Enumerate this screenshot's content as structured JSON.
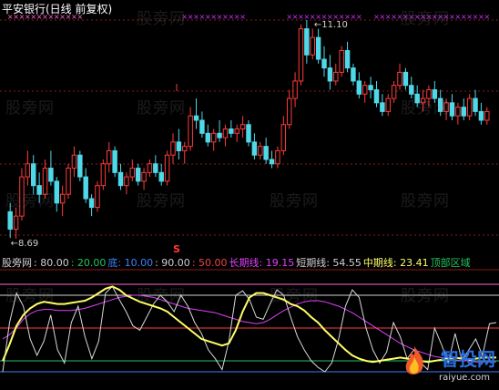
{
  "watermark": "股旁网",
  "title": "平安银行(日线 前复权)",
  "chart_data": [
    {
      "type": "candlestick",
      "name": "price",
      "annotations": {
        "high_label": "11.10",
        "low_label": "8.69",
        "signal_mark": "S"
      },
      "candles": [
        [
          9.0,
          9.1,
          8.7,
          8.8
        ],
        [
          8.8,
          9.05,
          8.69,
          8.95
        ],
        [
          8.95,
          9.5,
          8.9,
          9.4
        ],
        [
          9.4,
          9.7,
          9.3,
          9.55
        ],
        [
          9.55,
          9.65,
          9.2,
          9.3
        ],
        [
          9.3,
          9.45,
          9.1,
          9.2
        ],
        [
          9.2,
          9.6,
          9.15,
          9.5
        ],
        [
          9.5,
          9.7,
          9.3,
          9.35
        ],
        [
          9.35,
          9.4,
          9.0,
          9.1
        ],
        [
          9.1,
          9.3,
          8.95,
          9.2
        ],
        [
          9.2,
          9.55,
          9.15,
          9.5
        ],
        [
          9.5,
          9.75,
          9.4,
          9.65
        ],
        [
          9.65,
          9.7,
          9.35,
          9.4
        ],
        [
          9.4,
          9.5,
          9.1,
          9.15
        ],
        [
          9.15,
          9.2,
          8.95,
          9.05
        ],
        [
          9.05,
          9.35,
          9.0,
          9.3
        ],
        [
          9.3,
          9.6,
          9.25,
          9.55
        ],
        [
          9.55,
          9.8,
          9.45,
          9.7
        ],
        [
          9.7,
          9.75,
          9.4,
          9.45
        ],
        [
          9.45,
          9.55,
          9.25,
          9.3
        ],
        [
          9.3,
          9.45,
          9.2,
          9.4
        ],
        [
          9.4,
          9.6,
          9.35,
          9.5
        ],
        [
          9.5,
          9.55,
          9.3,
          9.35
        ],
        [
          9.35,
          9.5,
          9.25,
          9.45
        ],
        [
          9.45,
          9.6,
          9.4,
          9.55
        ],
        [
          9.55,
          9.65,
          9.4,
          9.45
        ],
        [
          9.45,
          9.55,
          9.3,
          9.35
        ],
        [
          9.35,
          9.7,
          9.3,
          9.65
        ],
        [
          9.65,
          9.9,
          9.55,
          9.8
        ],
        [
          9.8,
          9.95,
          9.6,
          9.7
        ],
        [
          9.7,
          9.8,
          9.55,
          9.75
        ],
        [
          9.75,
          10.2,
          9.7,
          10.1
        ],
        [
          10.1,
          10.3,
          9.95,
          10.05
        ],
        [
          10.05,
          10.15,
          9.85,
          9.9
        ],
        [
          9.9,
          10.0,
          9.75,
          9.8
        ],
        [
          9.8,
          9.95,
          9.7,
          9.9
        ],
        [
          9.9,
          10.05,
          9.8,
          9.85
        ],
        [
          9.85,
          10.0,
          9.75,
          9.95
        ],
        [
          9.95,
          10.05,
          9.85,
          9.9
        ],
        [
          9.9,
          10.0,
          9.8,
          9.95
        ],
        [
          9.95,
          10.1,
          9.85,
          10.0
        ],
        [
          10.0,
          10.05,
          9.75,
          9.8
        ],
        [
          9.8,
          9.9,
          9.6,
          9.65
        ],
        [
          9.65,
          9.8,
          9.6,
          9.75
        ],
        [
          9.75,
          9.85,
          9.55,
          9.6
        ],
        [
          9.6,
          9.7,
          9.5,
          9.55
        ],
        [
          9.55,
          9.75,
          9.5,
          9.7
        ],
        [
          9.7,
          10.1,
          9.65,
          10.0
        ],
        [
          10.0,
          10.4,
          9.95,
          10.3
        ],
        [
          10.3,
          10.6,
          10.2,
          10.5
        ],
        [
          10.5,
          11.15,
          10.45,
          11.1
        ],
        [
          11.1,
          11.2,
          10.7,
          10.8
        ],
        [
          10.8,
          11.1,
          10.75,
          11.0
        ],
        [
          11.0,
          11.1,
          10.7,
          10.75
        ],
        [
          10.75,
          10.9,
          10.55,
          10.65
        ],
        [
          10.65,
          10.8,
          10.4,
          10.5
        ],
        [
          10.5,
          10.7,
          10.45,
          10.6
        ],
        [
          10.6,
          10.9,
          10.55,
          10.85
        ],
        [
          10.85,
          10.95,
          10.6,
          10.65
        ],
        [
          10.65,
          10.7,
          10.45,
          10.5
        ],
        [
          10.5,
          10.6,
          10.3,
          10.35
        ],
        [
          10.35,
          10.5,
          10.25,
          10.45
        ],
        [
          10.45,
          10.55,
          10.3,
          10.4
        ],
        [
          10.4,
          10.5,
          10.2,
          10.25
        ],
        [
          10.25,
          10.35,
          10.1,
          10.15
        ],
        [
          10.15,
          10.35,
          10.1,
          10.3
        ],
        [
          10.3,
          10.5,
          10.25,
          10.45
        ],
        [
          10.45,
          10.7,
          10.4,
          10.6
        ],
        [
          10.6,
          10.65,
          10.4,
          10.45
        ],
        [
          10.45,
          10.55,
          10.3,
          10.35
        ],
        [
          10.35,
          10.45,
          10.2,
          10.25
        ],
        [
          10.25,
          10.4,
          10.15,
          10.3
        ],
        [
          10.3,
          10.45,
          10.2,
          10.4
        ],
        [
          10.4,
          10.5,
          10.25,
          10.3
        ],
        [
          10.3,
          10.4,
          10.1,
          10.15
        ],
        [
          10.15,
          10.3,
          10.05,
          10.25
        ],
        [
          10.25,
          10.35,
          10.05,
          10.1
        ],
        [
          10.1,
          10.25,
          10.0,
          10.2
        ],
        [
          10.2,
          10.3,
          10.05,
          10.1
        ],
        [
          10.1,
          10.35,
          10.05,
          10.3
        ],
        [
          10.3,
          10.4,
          10.1,
          10.15
        ],
        [
          10.15,
          10.25,
          10.0,
          10.05
        ],
        [
          10.05,
          10.2,
          10.0,
          10.15
        ]
      ],
      "signal_marks": [
        {
          "type": "pink",
          "range": [
            0,
            12
          ]
        },
        {
          "type": "magenta",
          "range": [
            30,
            40
          ]
        },
        {
          "type": "magenta",
          "range": [
            48,
            60
          ]
        },
        {
          "type": "magenta",
          "range": [
            63,
            83
          ]
        }
      ]
    },
    {
      "type": "line",
      "name": "indicator",
      "ylim": [
        0,
        100
      ],
      "header": [
        {
          "text": "股旁网",
          "color": "#d0d0d0"
        },
        {
          "text": ": 80.00",
          "color": "#d0d0d0"
        },
        {
          "text": ": 20.00",
          "color": "#22c55e"
        },
        {
          "text": "底: 10.00",
          "color": "#3b82f6"
        },
        {
          "text": ": 90.00",
          "color": "#d0d0d0"
        },
        {
          "text": ": 50.00",
          "color": "#ef4444"
        },
        {
          "text": "长期线: 19.15",
          "color": "#e040fb"
        },
        {
          "text": "短期线: 54.55",
          "color": "#d0d0d0"
        },
        {
          "text": "中期线: 23.41",
          "color": "#ffff66"
        },
        {
          "text": "顶部区域",
          "color": "#22c55e"
        }
      ],
      "hlines": [
        {
          "value": 90,
          "color": "#ff66cc"
        },
        {
          "value": 80,
          "color": "#d0d0d0"
        },
        {
          "value": 50,
          "color": "#ff3b3b"
        },
        {
          "value": 20,
          "color": "#22c55e"
        },
        {
          "value": 10,
          "color": "#3b82f6"
        }
      ],
      "series": [
        {
          "key": "long",
          "color": "#e040fb",
          "values": [
            40,
            44,
            50,
            58,
            63,
            66,
            67,
            67,
            66,
            66,
            66,
            67,
            68,
            70,
            72,
            74,
            76,
            78,
            79,
            80,
            80,
            79,
            78,
            76,
            74,
            72,
            70,
            68,
            67,
            66,
            65,
            64,
            62,
            60,
            58,
            56,
            55,
            54,
            55,
            58,
            62,
            66,
            69,
            72,
            74,
            75,
            75,
            74,
            72,
            70,
            67,
            64,
            60,
            56,
            52,
            48,
            44,
            40,
            36,
            33,
            30,
            28,
            26,
            24,
            23,
            22,
            21,
            20,
            20,
            19,
            19,
            19,
            19
          ]
        },
        {
          "key": "short",
          "color": "#d8d8d8",
          "values": [
            10,
            55,
            82,
            70,
            40,
            25,
            38,
            62,
            30,
            18,
            55,
            70,
            42,
            22,
            38,
            82,
            88,
            76,
            65,
            52,
            48,
            60,
            72,
            80,
            74,
            65,
            80,
            70,
            55,
            45,
            30,
            22,
            12,
            38,
            80,
            84,
            76,
            60,
            58,
            72,
            85,
            80,
            60,
            42,
            30,
            20,
            14,
            10,
            18,
            40,
            70,
            85,
            78,
            50,
            30,
            18,
            28,
            55,
            42,
            22,
            30,
            18,
            12,
            50,
            35,
            18,
            45,
            20,
            30,
            40,
            25,
            54,
            55
          ]
        },
        {
          "key": "mid",
          "color": "#ffff66",
          "values": [
            20,
            35,
            52,
            62,
            68,
            72,
            74,
            73,
            72,
            72,
            73,
            74,
            75,
            78,
            82,
            86,
            88,
            85,
            80,
            77,
            74,
            72,
            70,
            68,
            65,
            60,
            55,
            50,
            45,
            40,
            38,
            36,
            34,
            36,
            48,
            65,
            78,
            82,
            82,
            80,
            78,
            76,
            72,
            70,
            66,
            60,
            55,
            48,
            42,
            36,
            30,
            25,
            22,
            20,
            19,
            20,
            21,
            22,
            23,
            22,
            21,
            20,
            19,
            20,
            21,
            22,
            23,
            22,
            21,
            22,
            23,
            23,
            23
          ]
        }
      ]
    }
  ]
}
